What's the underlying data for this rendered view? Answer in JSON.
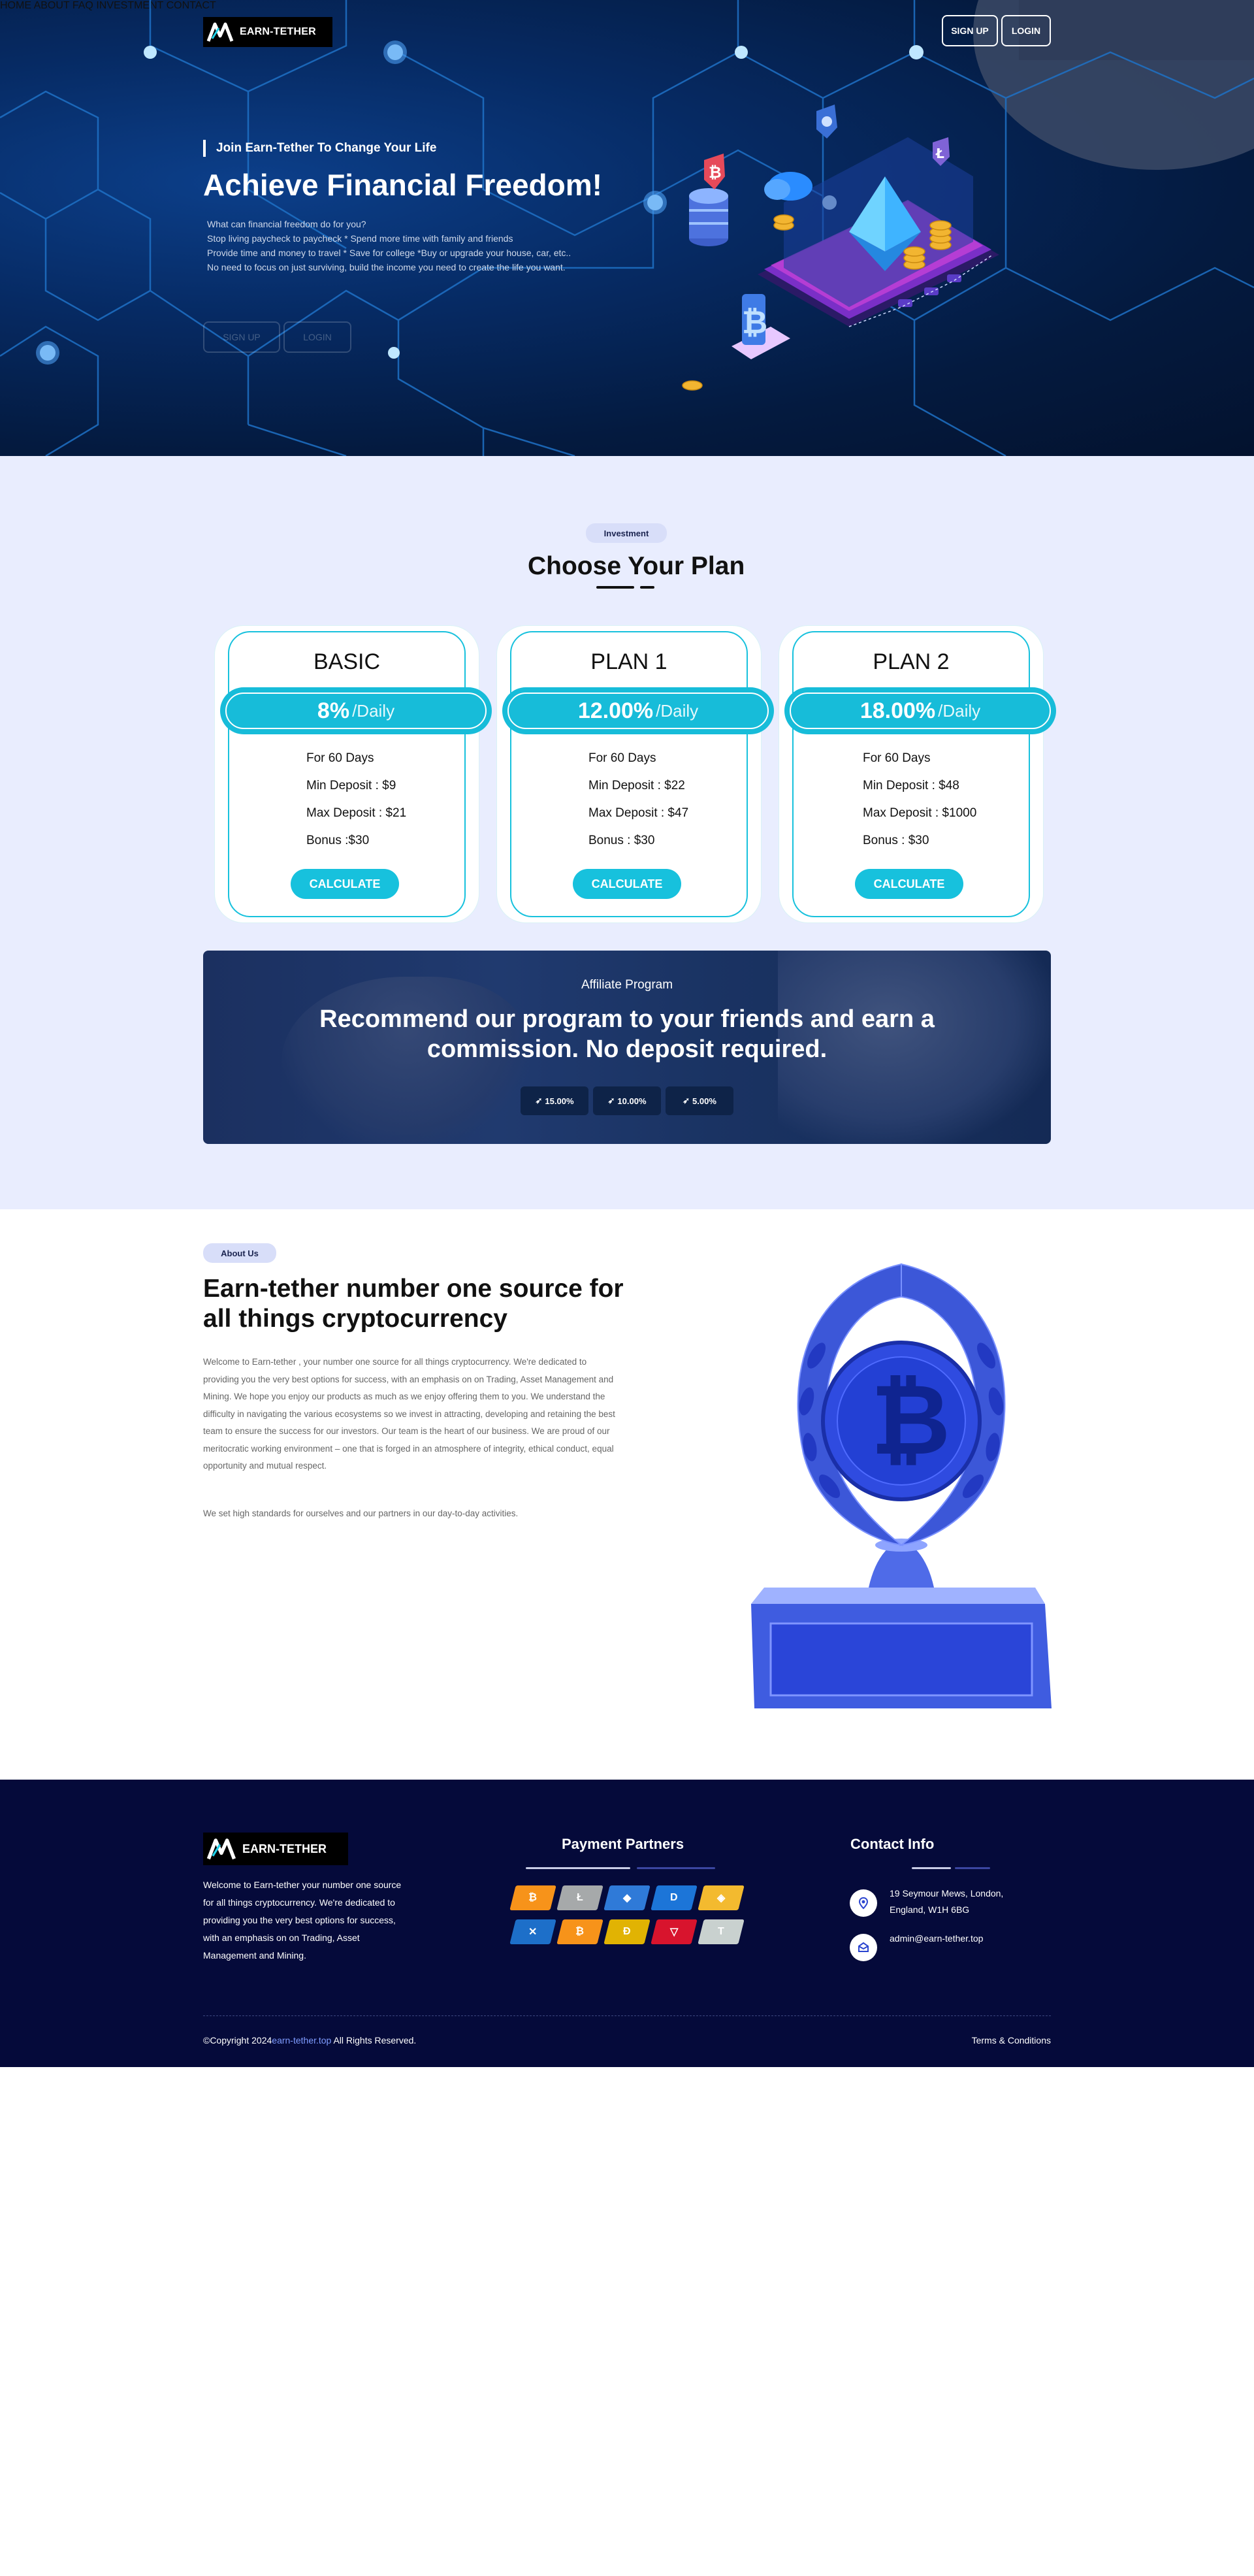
{
  "brand": {
    "name": "EARN-TETHER"
  },
  "nav": {
    "items": [
      "HOME",
      "ABOUT",
      "FAQ",
      "INVESTMENT",
      "CONTACT"
    ],
    "signup": "SIGN UP",
    "login": "LOGIN"
  },
  "hero": {
    "subtitle": "Join Earn-Tether To Change Your Life",
    "title": "Achieve Financial Freedom!",
    "lines": [
      "What can financial freedom do for you?",
      "Stop living paycheck to paycheck * Spend more time with family and friends",
      "Provide time and money to travel * Save for college *Buy or upgrade your house, car, etc..",
      "No need to focus on just surviving, build the income you need to create the life you want."
    ],
    "signup": "SIGN UP",
    "login": "LOGIN"
  },
  "plans_section": {
    "pill": "Investment",
    "title": "Choose Your Plan",
    "plans": [
      {
        "name": "BASIC",
        "rate": "8%",
        "period": "/Daily",
        "days": "For 60 Days",
        "min": "Min Deposit : $9",
        "max": "Max Deposit : $21",
        "bonus": "Bonus :$30",
        "button": "CALCULATE"
      },
      {
        "name": "PLAN 1",
        "rate": "12.00%",
        "period": "/Daily",
        "days": "For 60 Days",
        "min": "Min Deposit : $22",
        "max": "Max Deposit : $47",
        "bonus": "Bonus : $30",
        "button": "CALCULATE"
      },
      {
        "name": "PLAN 2",
        "rate": "18.00%",
        "period": "/Daily",
        "days": "For 60 Days",
        "min": "Min Deposit : $48",
        "max": "Max Deposit : $1000",
        "bonus": "Bonus : $30",
        "button": "CALCULATE"
      }
    ]
  },
  "affiliate": {
    "label": "Affiliate Program",
    "title_line1": "Recommend our program to your friends and earn a",
    "title_line2": "commission. No deposit required.",
    "levels": [
      "15.00%",
      "10.00%",
      "5.00%"
    ]
  },
  "about": {
    "pill": "About Us",
    "title": "Earn-tether number one source for all things cryptocurrency",
    "paragraph1": "Welcome to Earn-tether , your number one source for all things cryptocurrency. We're dedicated to providing you the very best options for success, with an emphasis on on Trading, Asset Management and Mining. We hope you enjoy our products as much as we enjoy offering them to you. We understand the difficulty in navigating the various ecosystems so we invest in attracting, developing and retaining the best team to ensure the success for our investors. Our team is the heart of our business. We are proud of our meritocratic working environment – one that is forged in an atmosphere of integrity, ethical conduct, equal opportunity and mutual respect.",
    "paragraph2": "We set high standards for ourselves and our partners in our day-to-day activities."
  },
  "footer": {
    "brand": "EARN-TETHER",
    "description": "Welcome to Earn-tether your number one source for all things cryptocurrency. We're dedicated to providing you the very best options for success, with an emphasis on on Trading, Asset Management and Mining.",
    "payment_title": "Payment Partners",
    "payment_icons": [
      {
        "name": "bitcoin-icon",
        "glyph": "₿",
        "color": "#f7931a"
      },
      {
        "name": "litecoin-icon",
        "glyph": "Ł",
        "color": "#a6a9aa"
      },
      {
        "name": "ethereum-icon",
        "glyph": "◆",
        "color": "#2f7ad8"
      },
      {
        "name": "dash-icon",
        "glyph": "D",
        "color": "#1c75d8"
      },
      {
        "name": "bnb-icon",
        "glyph": "◈",
        "color": "#f3ba2f"
      },
      {
        "name": "ripple-icon",
        "glyph": "✕",
        "color": "#1d6fc9"
      },
      {
        "name": "bitcoin-cash-icon",
        "glyph": "₿",
        "color": "#f7931a"
      },
      {
        "name": "dogecoin-icon",
        "glyph": "Ð",
        "color": "#e1b303"
      },
      {
        "name": "tron-icon",
        "glyph": "▽",
        "color": "#d8142d"
      },
      {
        "name": "tether-icon",
        "glyph": "T",
        "color": "#c9d1cf"
      }
    ],
    "contact_title": "Contact Info",
    "address_line1": "19 Seymour Mews, London,",
    "address_line2": "England, W1H 6BG",
    "email": "admin@earn-tether.top",
    "copyright_prefix": "©Copyright 2024",
    "copyright_link": "earn-tether.top",
    "copyright_suffix": " All Rights Reserved.",
    "terms": "Terms & Conditions"
  },
  "colors": {
    "accent": "#17c1dd",
    "hero_bg": "#062a63",
    "plans_bg": "#e9edfe",
    "footer_bg": "#050a3a"
  }
}
